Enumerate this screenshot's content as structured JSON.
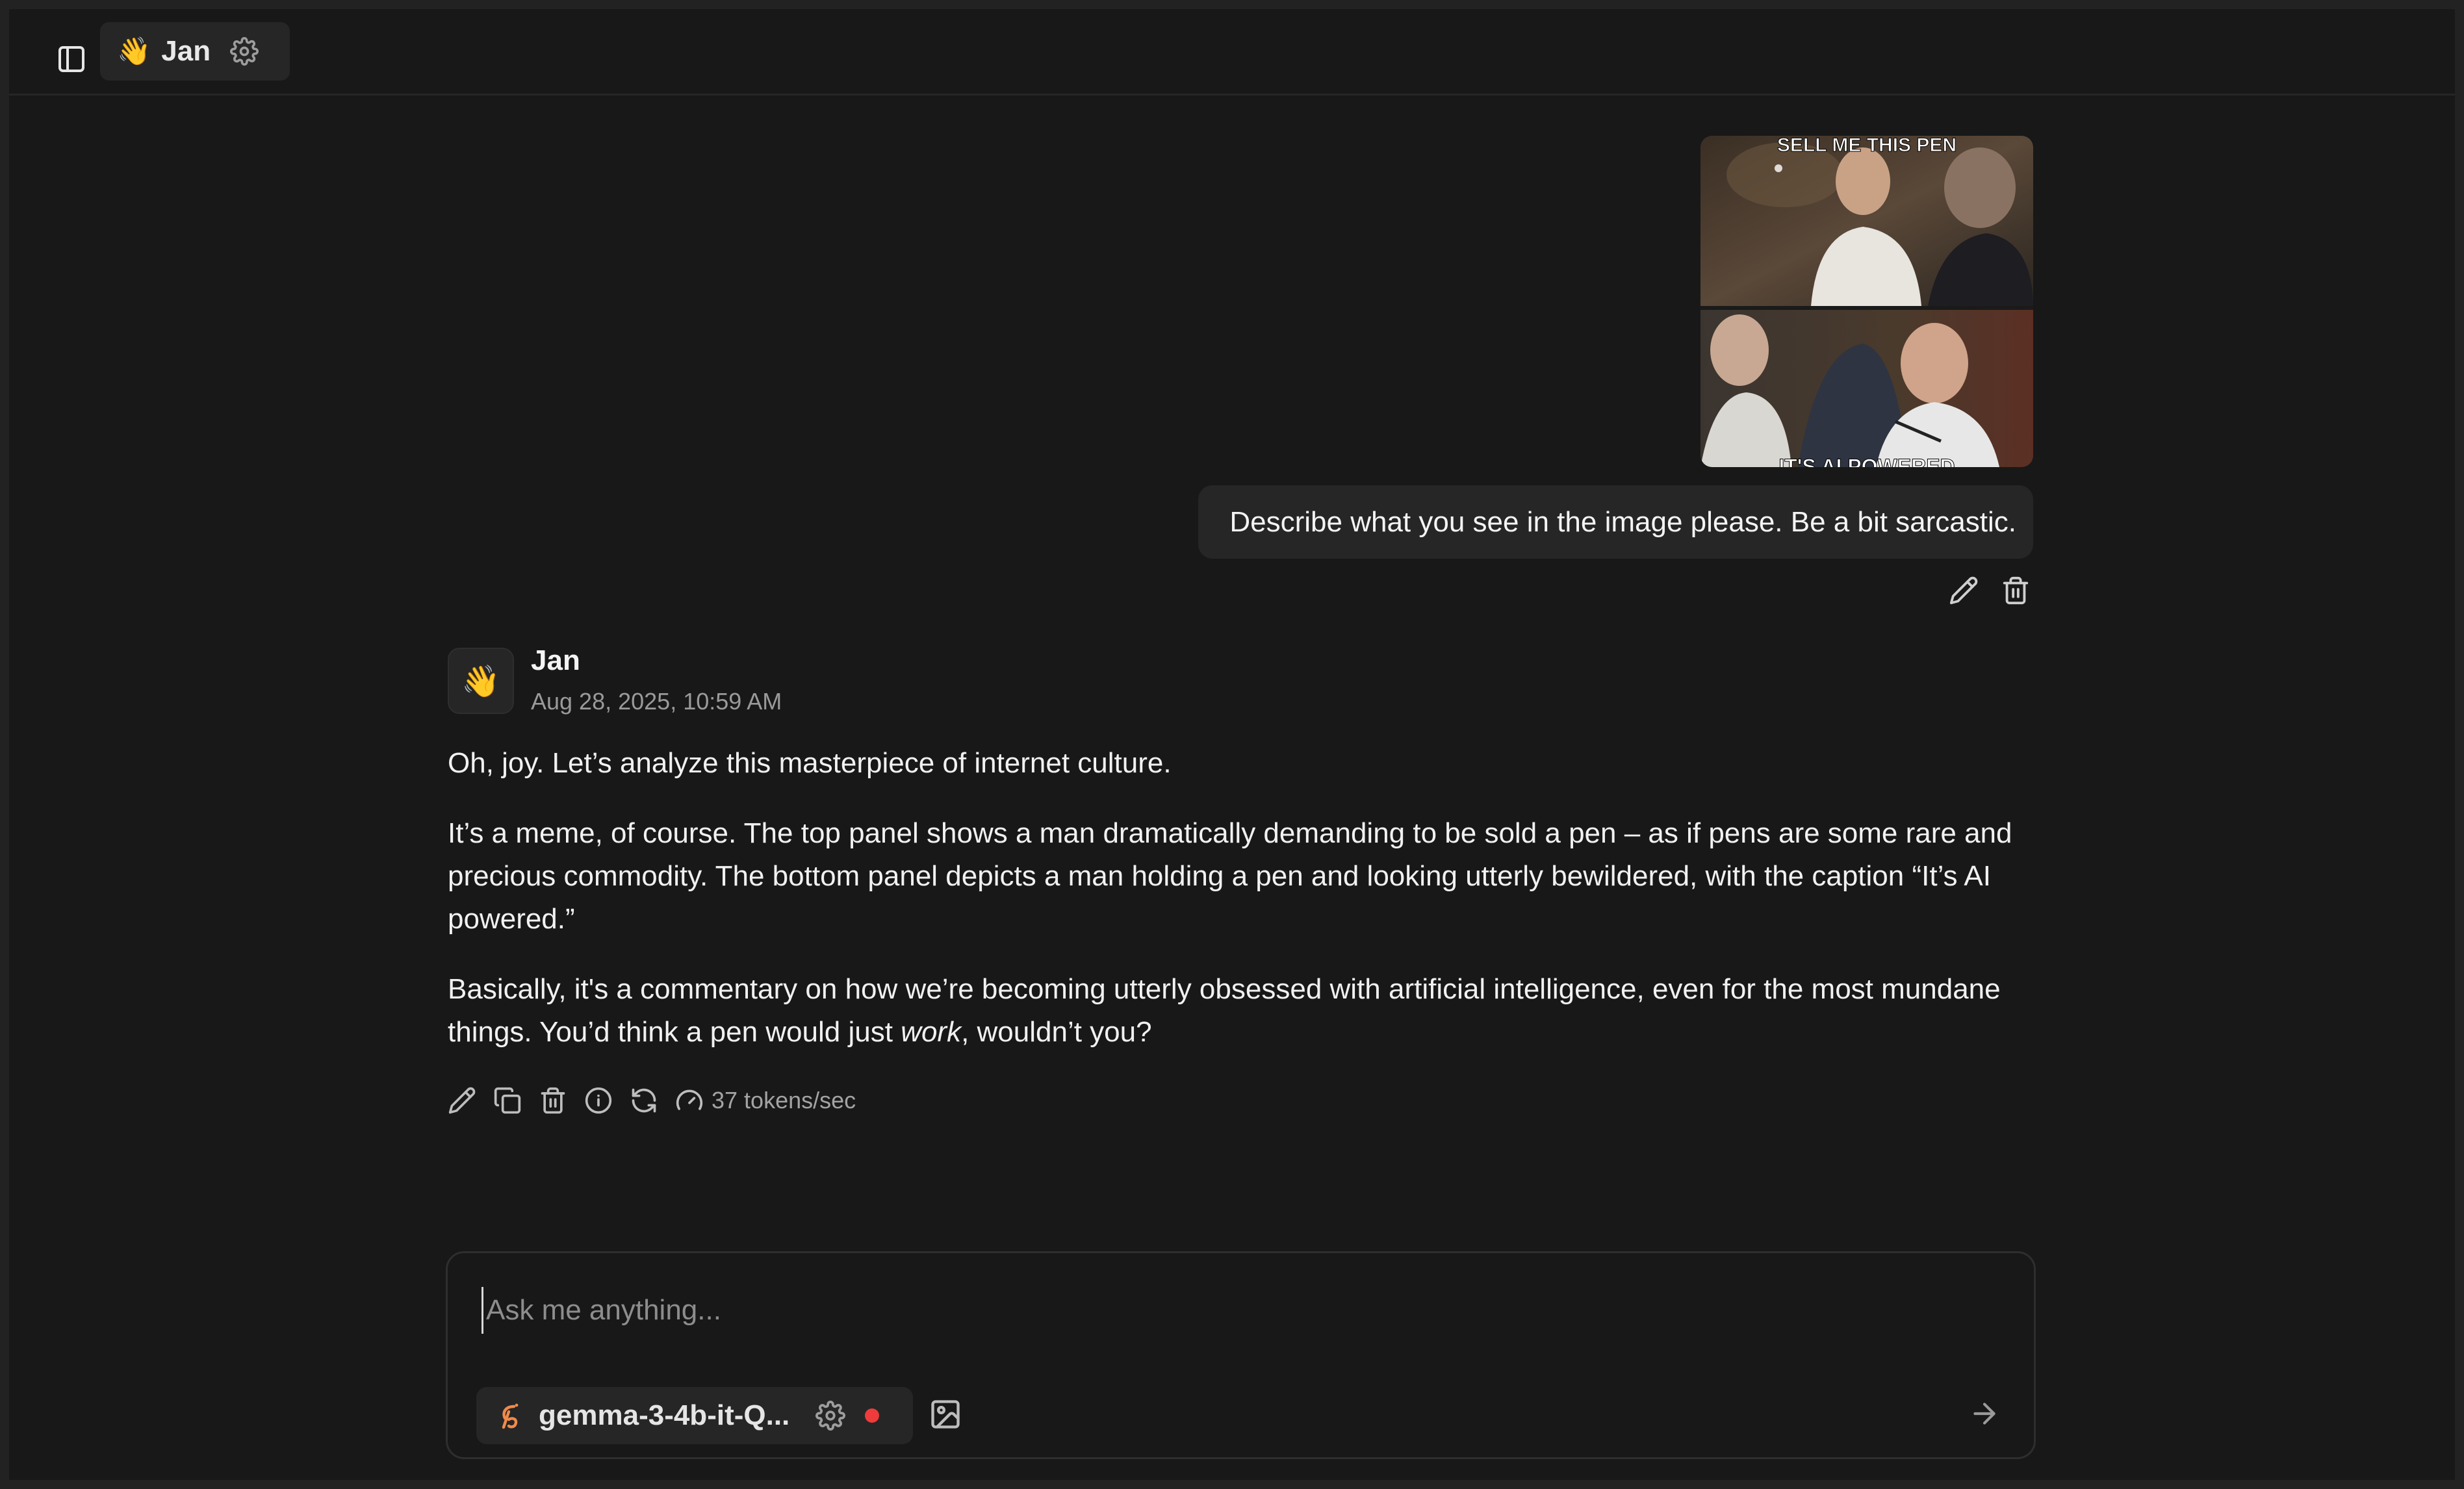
{
  "header": {
    "assistant_emoji": "👋",
    "assistant_name": "Jan"
  },
  "user_message": {
    "image_alt": "Meme image",
    "image_top_caption": "SELL ME THIS PEN",
    "image_bottom_caption": "IT'S AI POWERED",
    "text": "Describe what you see in the image please. Be a bit sarcastic."
  },
  "assistant_message": {
    "avatar_emoji": "👋",
    "name": "Jan",
    "timestamp": "Aug 28, 2025, 10:59 AM",
    "paragraphs": {
      "p1": "Oh, joy. Let’s analyze this masterpiece of internet culture.",
      "p2": "It’s a meme, of course. The top panel shows a man dramatically demanding to be sold a pen – as if pens are some rare and precious commodity. The bottom panel depicts a man holding a pen and looking utterly bewildered, with the caption “It’s AI powered.”",
      "p3_before": "Basically, it's a commentary on how we’re becoming utterly obsessed with artificial intelligence, even for the most mundane things. You’d think a pen would just ",
      "p3_emphasis": "work",
      "p3_after": ", wouldn’t you?"
    },
    "tokens_per_sec": "37 tokens/sec"
  },
  "composer": {
    "placeholder": "Ask me anything...",
    "value": "",
    "model_name": "gemma-3-4b-it-Q...",
    "status_color": "#ef3b3b"
  },
  "icons": {
    "sidebar_toggle": "sidebar-toggle-icon",
    "settings": "gear-icon",
    "edit": "pencil-icon",
    "delete": "trash-icon",
    "copy": "copy-icon",
    "info": "info-icon",
    "regenerate": "refresh-icon",
    "speed": "gauge-icon",
    "image": "image-icon",
    "send": "arrow-right-icon",
    "model_logo": "model-logo-icon"
  },
  "colors": {
    "background": "#181818",
    "surface": "#262626",
    "text": "#f1f1f1",
    "muted": "#9a9a9a",
    "accent_logo": "#f08a4b"
  }
}
